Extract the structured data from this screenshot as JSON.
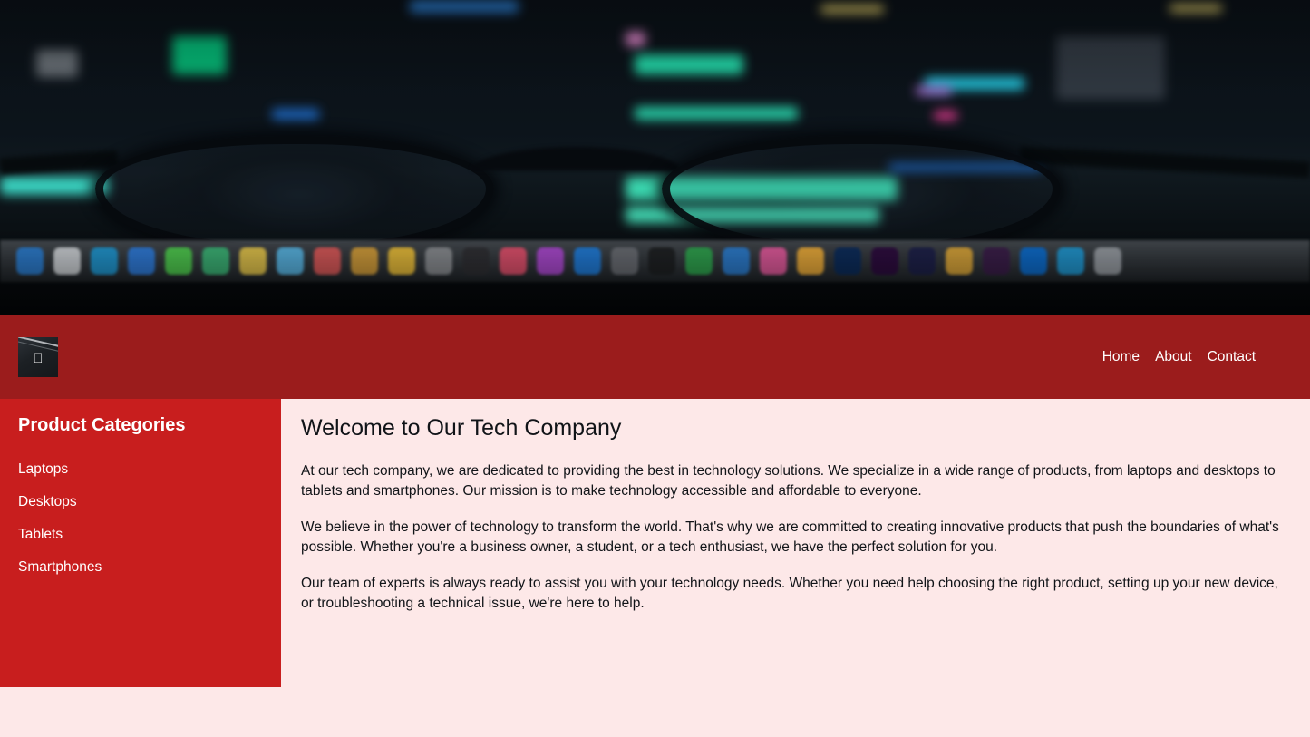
{
  "hero": {
    "alt": "Blurred photo of a dark computer screen with code, viewed through eyeglasses",
    "icon": "hero-banner-image",
    "dock_icons": [
      "finder-icon",
      "launchpad-icon",
      "safari-icon",
      "mail-icon",
      "messages-icon",
      "maps-icon",
      "photos-icon",
      "facetime-icon",
      "calendar-icon",
      "contacts-icon",
      "reminders-icon",
      "notes-icon",
      "tv-icon",
      "music-icon",
      "podcasts-icon",
      "appstore-icon",
      "settings-icon",
      "terminal-icon",
      "numbers-icon",
      "keynote-icon",
      "itunes-icon",
      "chrome-icon",
      "photoshop-icon",
      "premiere-icon",
      "aftereffects-icon",
      "sublime-icon",
      "slack-icon",
      "dropbox-icon",
      "finder2-icon",
      "trash-icon"
    ]
  },
  "header": {
    "logo": {
      "name": "site-logo",
      "glyph": ""
    },
    "nav": [
      {
        "label": "Home"
      },
      {
        "label": "About"
      },
      {
        "label": "Contact"
      }
    ]
  },
  "sidebar": {
    "title": "Product Categories",
    "categories": [
      {
        "label": "Laptops"
      },
      {
        "label": "Desktops"
      },
      {
        "label": "Tablets"
      },
      {
        "label": "Smartphones"
      }
    ]
  },
  "main": {
    "title": "Welcome to Our Tech Company",
    "paragraphs": [
      "At our tech company, we are dedicated to providing the best in technology solutions. We specialize in a wide range of products, from laptops and desktops to tablets and smartphones. Our mission is to make technology accessible and affordable to everyone.",
      "We believe in the power of technology to transform the world. That's why we are committed to creating innovative products that push the boundaries of what's possible. Whether you're a business owner, a student, or a tech enthusiast, we have the perfect solution for you.",
      "Our team of experts is always ready to assist you with your technology needs. Whether you need help choosing the right product, setting up your new device, or troubleshooting a technical issue, we're here to help."
    ]
  },
  "colors": {
    "header_red": "#9b1c1c",
    "sidebar_red": "#c81e1e",
    "page_background": "#fde8e8",
    "text_dark": "#111418",
    "text_light": "#ffffff"
  }
}
